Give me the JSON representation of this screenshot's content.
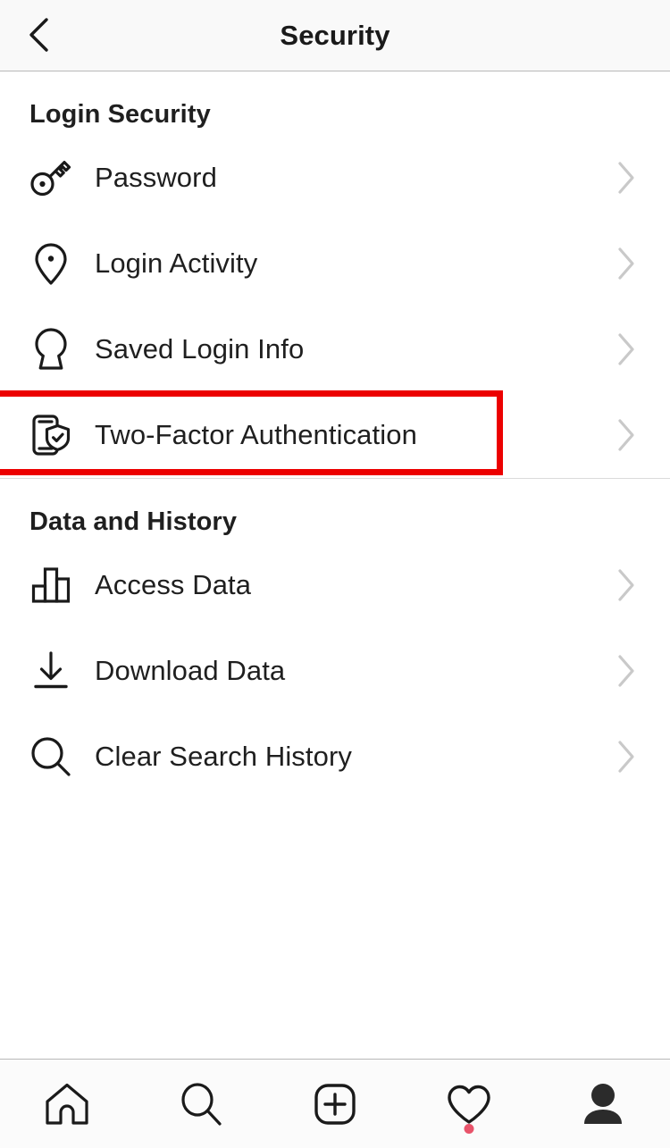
{
  "header": {
    "title": "Security",
    "back_icon": "chevron-left-icon"
  },
  "sections": [
    {
      "title": "Login Security",
      "items": [
        {
          "label": "Password",
          "icon": "key-icon",
          "chevron": "chevron-right-icon",
          "highlighted": false
        },
        {
          "label": "Login Activity",
          "icon": "location-pin-icon",
          "chevron": "chevron-right-icon",
          "highlighted": false
        },
        {
          "label": "Saved Login Info",
          "icon": "keyhole-icon",
          "chevron": "chevron-right-icon",
          "highlighted": false
        },
        {
          "label": "Two-Factor Authentication",
          "icon": "phone-shield-check-icon",
          "chevron": "chevron-right-icon",
          "highlighted": true
        }
      ]
    },
    {
      "title": "Data and History",
      "items": [
        {
          "label": "Access Data",
          "icon": "bar-chart-icon",
          "chevron": "chevron-right-icon",
          "highlighted": false
        },
        {
          "label": "Download Data",
          "icon": "download-arrow-icon",
          "chevron": "chevron-right-icon",
          "highlighted": false
        },
        {
          "label": "Clear Search History",
          "icon": "search-icon",
          "chevron": "chevron-right-icon",
          "highlighted": false
        }
      ]
    }
  ],
  "tabbar": {
    "items": [
      {
        "name": "home",
        "icon": "home-icon",
        "badge": false
      },
      {
        "name": "search",
        "icon": "search-icon",
        "badge": false
      },
      {
        "name": "create",
        "icon": "plus-box-icon",
        "badge": false
      },
      {
        "name": "activity",
        "icon": "heart-icon",
        "badge": true
      },
      {
        "name": "profile",
        "icon": "person-icon",
        "badge": false
      }
    ]
  },
  "colors": {
    "highlight": "#ec0000",
    "badge": "#e8536a",
    "chevron": "#c9c9c9",
    "text": "#1f1f1f",
    "header_bg": "#f9f9f9"
  }
}
